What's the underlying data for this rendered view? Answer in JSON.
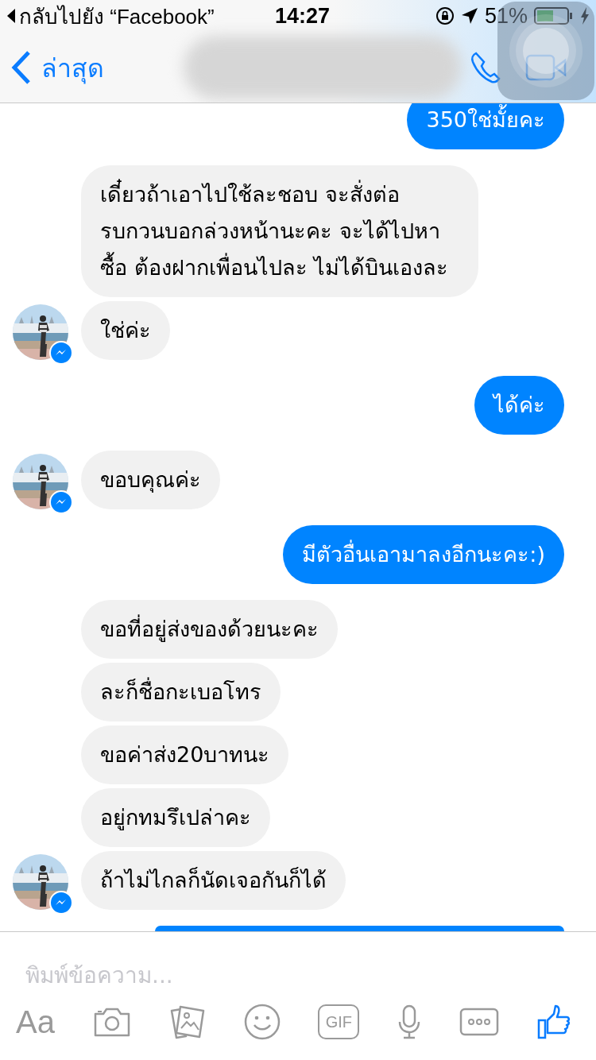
{
  "status_bar": {
    "back_app": "กลับไปยัง “Facebook”",
    "time": "14:27",
    "battery_percent": "51%"
  },
  "header": {
    "back_label": "ล่าสุด"
  },
  "messages": [
    {
      "kind": "outgoing",
      "text": "350ใช่มั้ยคะ"
    },
    {
      "kind": "incoming",
      "text": "เดี๋ยวถ้าเอาไปใช้ละชอบ จะสั่งต่อ รบกวนบอกล่วงหน้านะคะ จะได้ไปหา ซื้อ ต้องฝากเพื่อนไปละ ไม่ได้บินเองละ",
      "avatar": false
    },
    {
      "kind": "incoming",
      "text": "ใช่ค่ะ",
      "avatar": true
    },
    {
      "kind": "outgoing",
      "text": "ได้ค่ะ"
    },
    {
      "kind": "incoming",
      "text": "ขอบคุณค่ะ",
      "avatar": true
    },
    {
      "kind": "outgoing",
      "text": "มีตัวอื่นเอามาลงอีกนะคะ:)"
    },
    {
      "kind": "incoming",
      "text": "ขอที่อยู่ส่งของด้วยนะคะ",
      "avatar": false
    },
    {
      "kind": "incoming",
      "text": "ละก็ชื่อกะเบอโทร",
      "avatar": false
    },
    {
      "kind": "incoming",
      "text": "ขอค่าส่ง20บาทนะ",
      "avatar": false
    },
    {
      "kind": "incoming",
      "text": "อยู่กทมรึเปล่าคะ",
      "avatar": false
    },
    {
      "kind": "incoming",
      "text": "ถ้าไม่ไกลก็นัดเจอกันก็ได้",
      "avatar": true
    },
    {
      "kind": "outgoing-partial"
    }
  ],
  "composer": {
    "placeholder": "พิมพ์ข้อความ..."
  },
  "toolbar": [
    {
      "kind": "text",
      "label": "Aa"
    },
    {
      "kind": "camera"
    },
    {
      "kind": "gallery"
    },
    {
      "kind": "emoji"
    },
    {
      "kind": "gif",
      "label": "GIF"
    },
    {
      "kind": "mic"
    },
    {
      "kind": "more"
    },
    {
      "kind": "like"
    }
  ]
}
